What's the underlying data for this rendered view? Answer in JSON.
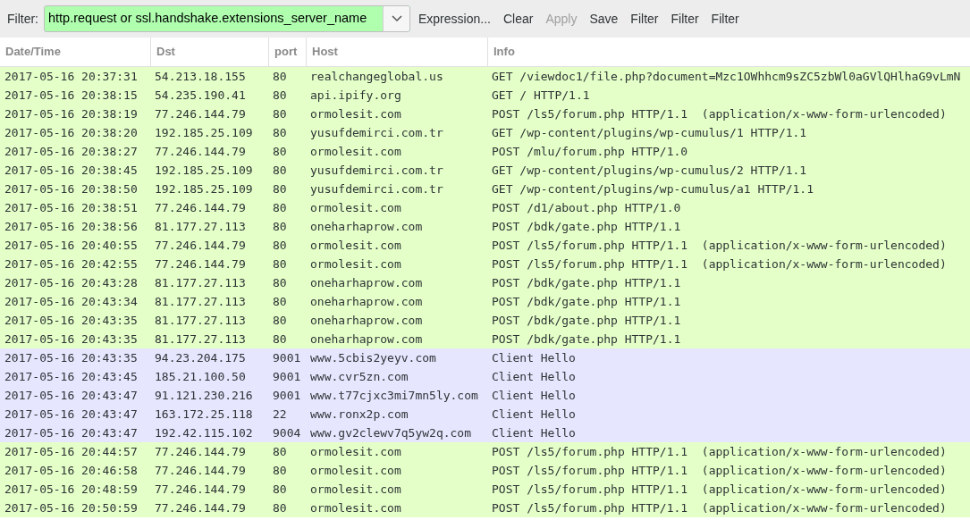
{
  "toolbar": {
    "label": "Filter:",
    "filter": {
      "value": "http.request or ssl.handshake.extensions_server_name",
      "valid": true
    },
    "buttons": [
      {
        "label": "Expression...",
        "disabled": false
      },
      {
        "label": "Clear",
        "disabled": false
      },
      {
        "label": "Apply",
        "disabled": true
      },
      {
        "label": "Save",
        "disabled": false
      },
      {
        "label": "Filter",
        "disabled": false
      },
      {
        "label": "Filter",
        "disabled": false
      },
      {
        "label": "Filter",
        "disabled": false
      }
    ]
  },
  "table": {
    "columns": [
      "Date/Time",
      "Dst",
      "port",
      "Host",
      "Info"
    ],
    "rows": [
      {
        "color": "#e4ffc7",
        "cells": [
          "2017-05-16 20:37:31",
          "54.213.18.155",
          "80",
          "realchangeglobal.us",
          "GET /viewdoc1/file.php?document=Mzc1OWhhcm9sZC5zbWl0aGVlQHlhaG9vLmN"
        ]
      },
      {
        "color": "#e4ffc7",
        "cells": [
          "2017-05-16 20:38:15",
          "54.235.190.41",
          "80",
          "api.ipify.org",
          "GET / HTTP/1.1"
        ]
      },
      {
        "color": "#e4ffc7",
        "cells": [
          "2017-05-16 20:38:19",
          "77.246.144.79",
          "80",
          "ormolesit.com",
          "POST /ls5/forum.php HTTP/1.1  (application/x-www-form-urlencoded)"
        ]
      },
      {
        "color": "#e4ffc7",
        "cells": [
          "2017-05-16 20:38:20",
          "192.185.25.109",
          "80",
          "yusufdemirci.com.tr",
          "GET /wp-content/plugins/wp-cumulus/1 HTTP/1.1"
        ]
      },
      {
        "color": "#e4ffc7",
        "cells": [
          "2017-05-16 20:38:27",
          "77.246.144.79",
          "80",
          "ormolesit.com",
          "POST /mlu/forum.php HTTP/1.0"
        ]
      },
      {
        "color": "#e4ffc7",
        "cells": [
          "2017-05-16 20:38:45",
          "192.185.25.109",
          "80",
          "yusufdemirci.com.tr",
          "GET /wp-content/plugins/wp-cumulus/2 HTTP/1.1"
        ]
      },
      {
        "color": "#e4ffc7",
        "cells": [
          "2017-05-16 20:38:50",
          "192.185.25.109",
          "80",
          "yusufdemirci.com.tr",
          "GET /wp-content/plugins/wp-cumulus/a1 HTTP/1.1"
        ]
      },
      {
        "color": "#e4ffc7",
        "cells": [
          "2017-05-16 20:38:51",
          "77.246.144.79",
          "80",
          "ormolesit.com",
          "POST /d1/about.php HTTP/1.0"
        ]
      },
      {
        "color": "#e4ffc7",
        "cells": [
          "2017-05-16 20:38:56",
          "81.177.27.113",
          "80",
          "oneharhaprow.com",
          "POST /bdk/gate.php HTTP/1.1"
        ]
      },
      {
        "color": "#e4ffc7",
        "cells": [
          "2017-05-16 20:40:55",
          "77.246.144.79",
          "80",
          "ormolesit.com",
          "POST /ls5/forum.php HTTP/1.1  (application/x-www-form-urlencoded)"
        ]
      },
      {
        "color": "#e4ffc7",
        "cells": [
          "2017-05-16 20:42:55",
          "77.246.144.79",
          "80",
          "ormolesit.com",
          "POST /ls5/forum.php HTTP/1.1  (application/x-www-form-urlencoded)"
        ]
      },
      {
        "color": "#e4ffc7",
        "cells": [
          "2017-05-16 20:43:28",
          "81.177.27.113",
          "80",
          "oneharhaprow.com",
          "POST /bdk/gate.php HTTP/1.1"
        ]
      },
      {
        "color": "#e4ffc7",
        "cells": [
          "2017-05-16 20:43:34",
          "81.177.27.113",
          "80",
          "oneharhaprow.com",
          "POST /bdk/gate.php HTTP/1.1"
        ]
      },
      {
        "color": "#e4ffc7",
        "cells": [
          "2017-05-16 20:43:35",
          "81.177.27.113",
          "80",
          "oneharhaprow.com",
          "POST /bdk/gate.php HTTP/1.1"
        ]
      },
      {
        "color": "#e4ffc7",
        "cells": [
          "2017-05-16 20:43:35",
          "81.177.27.113",
          "80",
          "oneharhaprow.com",
          "POST /bdk/gate.php HTTP/1.1"
        ]
      },
      {
        "color": "#e7e6ff",
        "cells": [
          "2017-05-16 20:43:35",
          "94.23.204.175",
          "9001",
          "www.5cbis2yeyv.com",
          "Client Hello"
        ]
      },
      {
        "color": "#e7e6ff",
        "cells": [
          "2017-05-16 20:43:45",
          "185.21.100.50",
          "9001",
          "www.cvr5zn.com",
          "Client Hello"
        ]
      },
      {
        "color": "#e7e6ff",
        "cells": [
          "2017-05-16 20:43:47",
          "91.121.230.216",
          "9001",
          "www.t77cjxc3mi7mn5ly.com",
          "Client Hello"
        ]
      },
      {
        "color": "#e7e6ff",
        "cells": [
          "2017-05-16 20:43:47",
          "163.172.25.118",
          "22",
          "www.ronx2p.com",
          "Client Hello"
        ]
      },
      {
        "color": "#e7e6ff",
        "cells": [
          "2017-05-16 20:43:47",
          "192.42.115.102",
          "9004",
          "www.gv2clewv7q5yw2q.com",
          "Client Hello"
        ]
      },
      {
        "color": "#e4ffc7",
        "cells": [
          "2017-05-16 20:44:57",
          "77.246.144.79",
          "80",
          "ormolesit.com",
          "POST /ls5/forum.php HTTP/1.1  (application/x-www-form-urlencoded)"
        ]
      },
      {
        "color": "#e4ffc7",
        "cells": [
          "2017-05-16 20:46:58",
          "77.246.144.79",
          "80",
          "ormolesit.com",
          "POST /ls5/forum.php HTTP/1.1  (application/x-www-form-urlencoded)"
        ]
      },
      {
        "color": "#e4ffc7",
        "cells": [
          "2017-05-16 20:48:59",
          "77.246.144.79",
          "80",
          "ormolesit.com",
          "POST /ls5/forum.php HTTP/1.1  (application/x-www-form-urlencoded)"
        ]
      },
      {
        "color": "#e4ffc7",
        "cells": [
          "2017-05-16 20:50:59",
          "77.246.144.79",
          "80",
          "ormolesit.com",
          "POST /ls5/forum.php HTTP/1.1  (application/x-www-form-urlencoded)"
        ]
      }
    ]
  }
}
